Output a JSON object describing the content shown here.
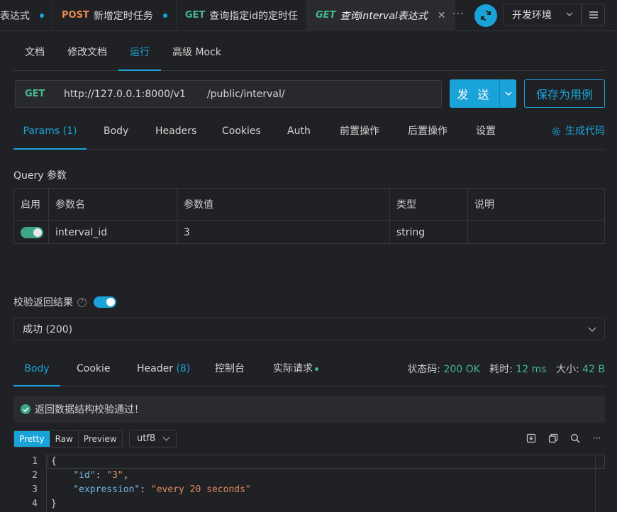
{
  "tabs": [
    {
      "method": "",
      "title": "表达式",
      "dot": true
    },
    {
      "method": "POST",
      "title": "新增定时任务",
      "dot": true
    },
    {
      "method": "GET",
      "title": "查询指定id的定时任",
      "dot": false
    },
    {
      "method": "GET",
      "title": "查询interval表达式",
      "dot": false,
      "active": true
    }
  ],
  "env": {
    "label": "开发环境"
  },
  "subnav": [
    "文档",
    "修改文档",
    "运行",
    "高级 Mock"
  ],
  "request": {
    "method": "GET",
    "base_url": "http://127.0.0.1:8000/v1",
    "path": "/public/interval/",
    "send_label": "发 送",
    "save_label": "保存为用例"
  },
  "param_tabs": [
    "Params (1)",
    "Body",
    "Headers",
    "Cookies",
    "Auth",
    "前置操作",
    "后置操作",
    "设置"
  ],
  "gen_code_label": "生成代码",
  "query": {
    "title": "Query 参数",
    "headers": [
      "启用",
      "参数名",
      "参数值",
      "类型",
      "说明"
    ],
    "rows": [
      {
        "enabled": true,
        "name": "interval_id",
        "value": "3",
        "type": "string",
        "desc": ""
      }
    ]
  },
  "validate": {
    "label": "校验返回结果",
    "enabled": true,
    "selected": "成功 (200)"
  },
  "response_tabs": {
    "body": "Body",
    "cookie": "Cookie",
    "header": "Header",
    "header_count": "(8)",
    "console": "控制台",
    "actual": "实际请求"
  },
  "status": {
    "code_label": "状态码:",
    "code": "200 OK",
    "time_label": "耗时:",
    "time": "12 ms",
    "size_label": "大小:",
    "size": "42 B"
  },
  "ok_message": "返回数据结构校验通过！",
  "format": {
    "options": [
      "Pretty",
      "Raw",
      "Preview"
    ],
    "selected": "Pretty",
    "encoding": "utf8"
  },
  "code_lines": {
    "n1": "1",
    "n2": "2",
    "n3": "3",
    "n4": "4",
    "l1": "{",
    "l2_key": "\"id\"",
    "l2_val": "\"3\"",
    "l3_key": "\"expression\"",
    "l3_val": "\"every 20 seconds\"",
    "l4": "}"
  },
  "colors": {
    "accent": "#1aa3d8",
    "get": "#45b88f",
    "post": "#e98a4c"
  }
}
